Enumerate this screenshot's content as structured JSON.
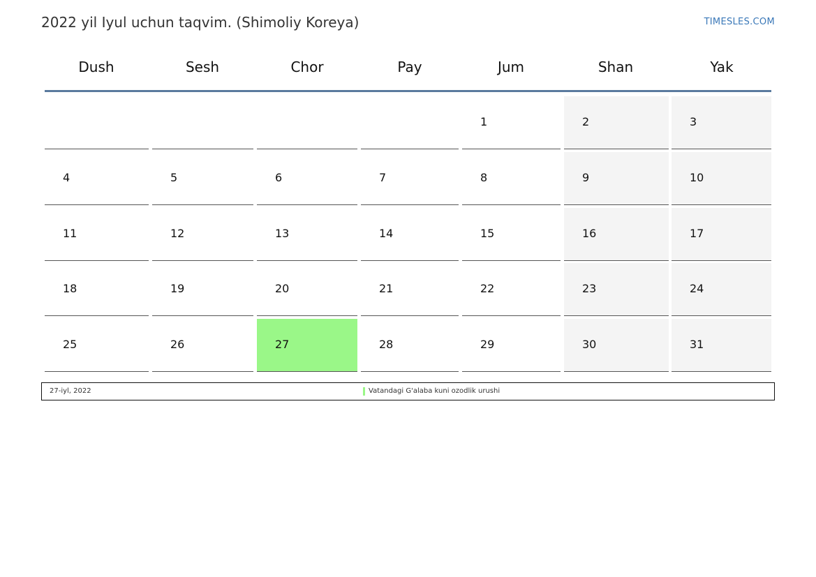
{
  "header": {
    "title": "2022 yil Iyul uchun taqvim. (Shimoliy Koreya)",
    "brand": "TIMESLES.COM"
  },
  "weekdays": [
    "Dush",
    "Sesh",
    "Chor",
    "Pay",
    "Jum",
    "Shan",
    "Yak"
  ],
  "weeks": [
    [
      "",
      "",
      "",
      "",
      "1",
      "2",
      "3"
    ],
    [
      "4",
      "5",
      "6",
      "7",
      "8",
      "9",
      "10"
    ],
    [
      "11",
      "12",
      "13",
      "14",
      "15",
      "16",
      "17"
    ],
    [
      "18",
      "19",
      "20",
      "21",
      "22",
      "23",
      "24"
    ],
    [
      "25",
      "26",
      "27",
      "28",
      "29",
      "30",
      "31"
    ]
  ],
  "holidays": [
    {
      "day": "27",
      "date_label": "27-iyl, 2022",
      "name": "Vatandagi G'alaba kuni ozodlik urushi"
    }
  ],
  "colors": {
    "holiday": "#9af788",
    "weekend": "#f4f4f4",
    "header_rule": "#5a7a9e",
    "brand": "#3a78b8"
  }
}
